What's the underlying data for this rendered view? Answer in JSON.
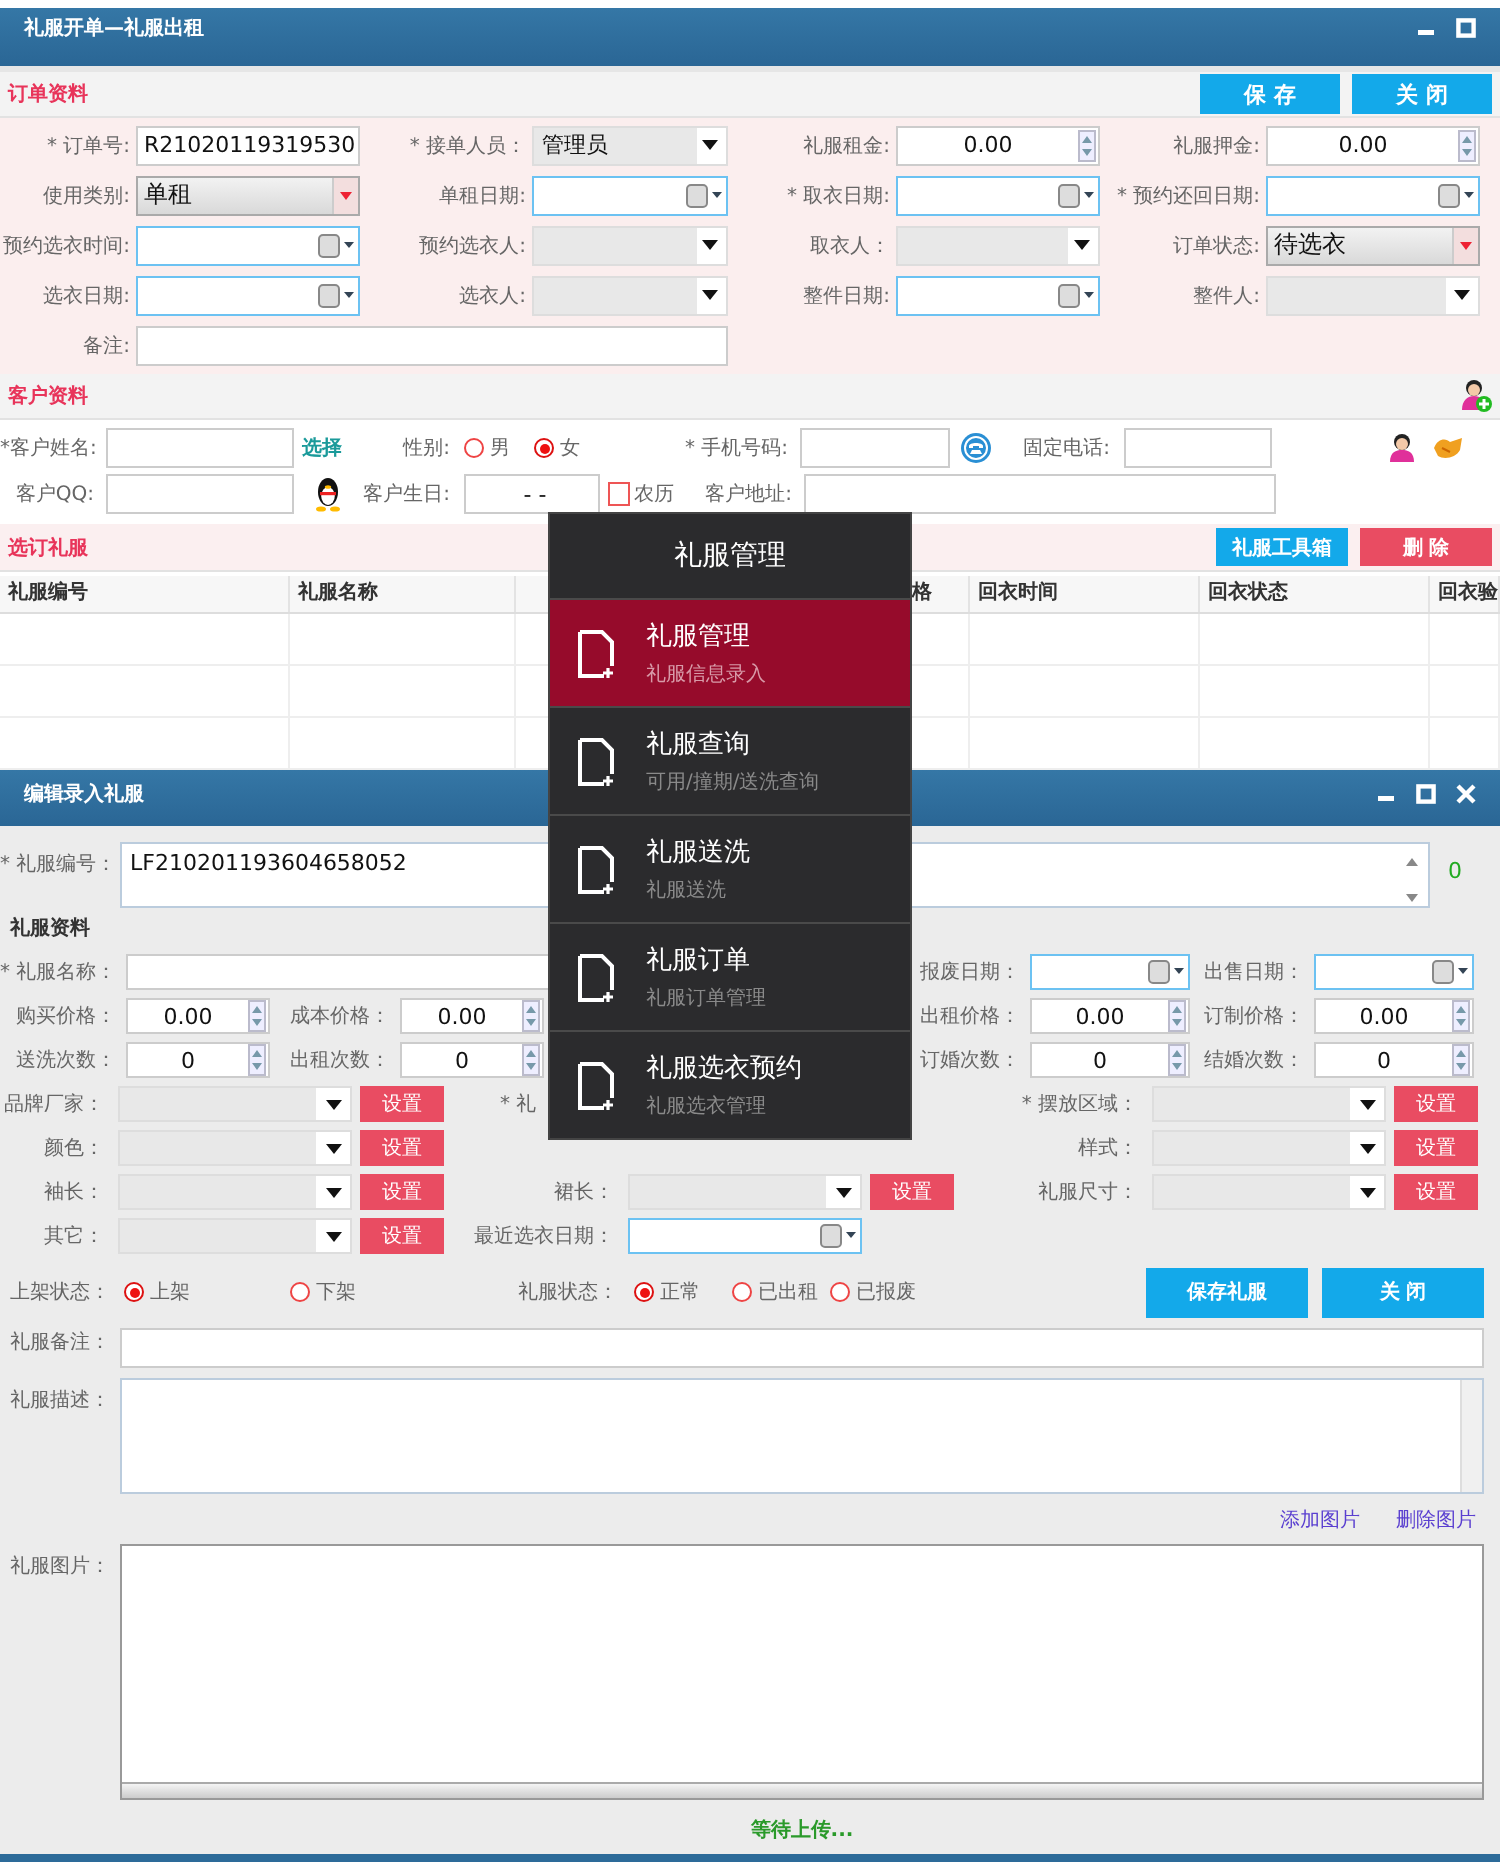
{
  "order_window": {
    "title": "礼服开单—礼服出租",
    "order_section": {
      "title": "订单资料",
      "buttons": [
        {
          "label": "保 存"
        },
        {
          "label": "关 闭"
        }
      ]
    },
    "order_rows": [
      {
        "fields": [
          {
            "label": "* 订单号:",
            "kind": "text",
            "value": "R21020119319530"
          },
          {
            "label": "* 接单人员：",
            "kind": "select",
            "value": "管理员"
          },
          {
            "label": "礼服租金:",
            "kind": "spin",
            "value": "0.00"
          },
          {
            "label": "礼服押金:",
            "kind": "spin",
            "value": "0.00"
          }
        ]
      },
      {
        "fields": [
          {
            "label": "使用类别:",
            "kind": "combo",
            "value": "单租"
          },
          {
            "label": "单租日期:",
            "kind": "date"
          },
          {
            "label": "* 取衣日期:",
            "kind": "date"
          },
          {
            "label": "* 预约还回日期:",
            "kind": "date"
          }
        ]
      },
      {
        "fields": [
          {
            "label": "预约选衣时间:",
            "kind": "date"
          },
          {
            "label": "预约选衣人:",
            "kind": "select"
          },
          {
            "label": "取衣人：",
            "kind": "select"
          },
          {
            "label": "订单状态:",
            "kind": "combo",
            "value": "待选衣"
          }
        ]
      },
      {
        "fields": [
          {
            "label": "选衣日期:",
            "kind": "date"
          },
          {
            "label": "选衣人:",
            "kind": "select"
          },
          {
            "label": "整件日期:",
            "kind": "date"
          },
          {
            "label": "整件人:",
            "kind": "select"
          }
        ]
      },
      {
        "fields": [
          {
            "label": "备注:",
            "kind": "memo"
          }
        ]
      }
    ],
    "customer": {
      "title": "客户资料",
      "name": {
        "label": "*客户姓名:"
      },
      "select_link": "选择",
      "gender": {
        "label": "性别:",
        "options": [
          {
            "label": "男",
            "selected": false
          },
          {
            "label": "女",
            "selected": true
          }
        ]
      },
      "mobile": {
        "label": "* 手机号码:"
      },
      "phone": {
        "label": "固定电话:"
      },
      "qq": {
        "label": "客户QQ:"
      },
      "birthday": {
        "label": "客户生日:",
        "value": "-  -"
      },
      "lunar": {
        "label": "农历",
        "checked": false
      },
      "address": {
        "label": "客户地址:"
      }
    },
    "dresses": {
      "title": "选订礼服",
      "buttons": [
        {
          "label": "礼服工具箱",
          "kind": "primary"
        },
        {
          "label": "删 除",
          "kind": "danger"
        }
      ],
      "columns": [
        "礼服编号",
        "礼服名称",
        "格",
        "回衣时间",
        "回衣状态",
        "回衣验"
      ]
    }
  },
  "dress_window": {
    "title": "编辑录入礼服",
    "code": {
      "label": "* 礼服编号：",
      "value": "LF210201193604658052",
      "count": "0"
    },
    "section_title": "礼服资料",
    "rows": [
      {
        "kind": "names",
        "left": [
          {
            "label": "* 礼服名称：",
            "kind": "text"
          }
        ],
        "right": [
          {
            "label": "报废日期：",
            "kind": "date"
          },
          {
            "label": "出售日期：",
            "kind": "date"
          }
        ]
      },
      {
        "kind": "spins",
        "left": [
          {
            "label": "购买价格：",
            "kind": "spin",
            "value": "0.00"
          },
          {
            "label": "成本价格：",
            "kind": "spin",
            "value": "0.00"
          }
        ],
        "right": [
          {
            "label": "出租价格：",
            "kind": "spin",
            "value": "0.00"
          },
          {
            "label": "订制价格：",
            "kind": "spin",
            "value": "0.00"
          }
        ]
      },
      {
        "kind": "spins",
        "left": [
          {
            "label": "送洗次数：",
            "kind": "spin",
            "value": "0"
          },
          {
            "label": "出租次数：",
            "kind": "spin",
            "value": "0"
          }
        ],
        "right": [
          {
            "label": "订婚次数：",
            "kind": "spin",
            "value": "0"
          },
          {
            "label": "结婚次数：",
            "kind": "spin",
            "value": "0"
          }
        ]
      },
      {
        "kind": "selects",
        "left": [
          {
            "label": "品牌厂家：",
            "kind": "select",
            "button": "设置"
          }
        ],
        "middle": [
          {
            "label": "* 礼"
          }
        ],
        "right": [
          {
            "label": "* 摆放区域：",
            "kind": "select",
            "button": "设置"
          }
        ]
      },
      {
        "kind": "selects",
        "left": [
          {
            "label": "颜色：",
            "kind": "select",
            "button": "设置"
          }
        ],
        "right": [
          {
            "label": "样式：",
            "kind": "select",
            "button": "设置"
          }
        ]
      },
      {
        "kind": "selects",
        "left": [
          {
            "label": "袖长：",
            "kind": "select",
            "button": "设置"
          }
        ],
        "middle": [
          {
            "label": "裙长：",
            "kind": "select",
            "button": "设置"
          }
        ],
        "right": [
          {
            "label": "礼服尺寸：",
            "kind": "select",
            "button": "设置"
          }
        ]
      },
      {
        "kind": "selects",
        "left": [
          {
            "label": "其它：",
            "kind": "select",
            "button": "设置"
          }
        ],
        "middle": [
          {
            "label": "最近选衣日期：",
            "kind": "date"
          }
        ]
      }
    ],
    "status": {
      "shelf": {
        "label": "上架状态：",
        "options": [
          {
            "label": "上架",
            "selected": true
          },
          {
            "label": "下架",
            "selected": false
          }
        ]
      },
      "dress_state": {
        "label": "礼服状态：",
        "options": [
          {
            "label": "正常",
            "selected": true
          },
          {
            "label": "已出租",
            "selected": false
          },
          {
            "label": "已报废",
            "selected": false
          }
        ]
      },
      "buttons": [
        {
          "label": "保存礼服"
        },
        {
          "label": "关 闭"
        }
      ]
    },
    "remark": {
      "label": "礼服备注："
    },
    "description": {
      "label": "礼服描述："
    },
    "picture_links": [
      "添加图片",
      "删除图片"
    ],
    "pictures": {
      "label": "礼服图片："
    },
    "upload_status": "等待上传..."
  },
  "menu": {
    "title": "礼服管理",
    "items": [
      {
        "title": "礼服管理",
        "subtitle": "礼服信息录入",
        "selected": true
      },
      {
        "title": "礼服查询",
        "subtitle": "可用/撞期/送洗查询",
        "selected": false
      },
      {
        "title": "礼服送洗",
        "subtitle": "礼服送洗",
        "selected": false
      },
      {
        "title": "礼服订单",
        "subtitle": "礼服订单管理",
        "selected": false
      },
      {
        "title": "礼服选衣预约",
        "subtitle": "礼服选衣管理",
        "selected": false
      }
    ]
  }
}
